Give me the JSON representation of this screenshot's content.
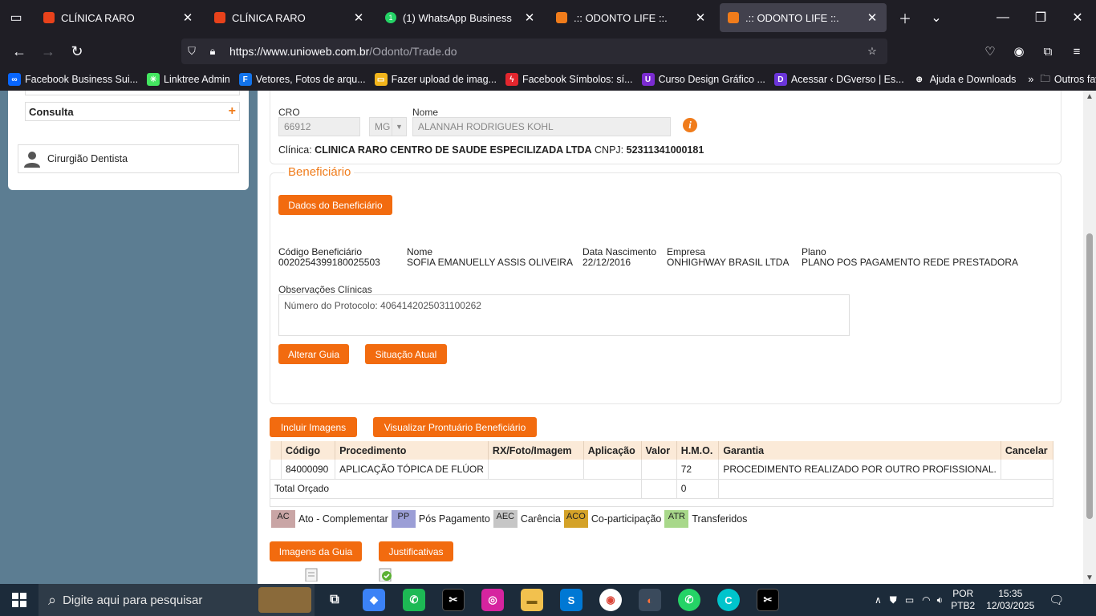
{
  "browser": {
    "tabs": [
      {
        "title": "CLÍNICA RARO",
        "fav_color": "#e8421b",
        "active": false
      },
      {
        "title": "CLÍNICA RARO",
        "fav_color": "#e8421b",
        "active": false
      },
      {
        "title": "(1) WhatsApp Business",
        "fav_color": "#25d366",
        "badge": "1",
        "active": false
      },
      {
        "title": ".:: ODONTO LIFE ::.",
        "fav_color": "#f07c1b",
        "active": false
      },
      {
        "title": ".:: ODONTO LIFE ::.",
        "fav_color": "#f07c1b",
        "active": true
      }
    ],
    "url_host": "https://www.unioweb.com.br",
    "url_path": "/Odonto/Trade.do",
    "bookmarks": [
      {
        "label": "Facebook Business Sui...",
        "color": "#0866ff",
        "glyph": "∞"
      },
      {
        "label": "Linktree Admin",
        "color": "#43e660",
        "glyph": "✳"
      },
      {
        "label": "Vetores, Fotos de arqu...",
        "color": "#1273eb",
        "glyph": "F"
      },
      {
        "label": "Fazer upload de imag...",
        "color": "#f2b51b",
        "glyph": "▭"
      },
      {
        "label": "Facebook Símbolos: sí...",
        "color": "#e3262e",
        "glyph": "ϟ"
      },
      {
        "label": "Curso Design Gráfico ...",
        "color": "#7b2bd1",
        "glyph": "U"
      },
      {
        "label": "Acessar ‹ DGverso | Es...",
        "color": "#6b35d9",
        "glyph": "D"
      },
      {
        "label": "Ajuda e Downloads",
        "color": "#1f1e25",
        "glyph": "⊕"
      }
    ],
    "other_bookmarks": "Outros favoritos"
  },
  "sidebar": {
    "consulta": "Consulta",
    "plus": "+",
    "profile": "Cirurgião Dentista"
  },
  "provider": {
    "cro_label": "CRO",
    "cro_value": "66912",
    "uf_value": "MG",
    "nome_label": "Nome",
    "nome_value": "ALANNAH RODRIGUES KOHL",
    "info_glyph": "i",
    "clinica_label": "Clínica:",
    "clinica_name": "CLINICA RARO CENTRO DE SAUDE ESPECILIZADA LTDA",
    "cnpj_label": "CNPJ:",
    "cnpj_value": "52311341000181"
  },
  "beneficiario": {
    "legend": "Beneficiário",
    "dados_button": "Dados do Beneficiário",
    "fields": [
      {
        "label": "Código Beneficiário",
        "value": "0020254399180025503"
      },
      {
        "label": "Nome",
        "value": "SOFIA EMANUELLY ASSIS OLIVEIRA"
      },
      {
        "label": "Data Nascimento",
        "value": "22/12/2016"
      },
      {
        "label": "Empresa",
        "value": "ONHIGHWAY BRASIL LTDA"
      },
      {
        "label": "Plano",
        "value": "PLANO POS PAGAMENTO REDE PRESTADORA"
      }
    ],
    "obs_label": "Observações Clínicas",
    "obs_text": "Número do Protocolo: 4064142025031100262",
    "alterar_button": "Alterar Guia",
    "situacao_button": "Situação Atual"
  },
  "actions": {
    "incluir_imagens": "Incluir Imagens",
    "visualizar_prontuario": "Visualizar Prontuário Beneficiário",
    "imagens_guia": "Imagens da Guia",
    "justificativas": "Justificativas"
  },
  "table": {
    "headers": [
      "",
      "Código",
      "Procedimento",
      "RX/Foto/Imagem",
      "Aplicação",
      "Valor",
      "H.M.O.",
      "Garantia",
      "Cancelar"
    ],
    "rows": [
      [
        "",
        "84000090",
        "APLICAÇÃO TÓPICA DE FLÚOR",
        "",
        "",
        "",
        "72",
        "PROCEDIMENTO REALIZADO POR OUTRO PROFISSIONAL.",
        ""
      ]
    ],
    "total_label": "Total Orçado",
    "total_hmo": "0"
  },
  "legend_chips": [
    {
      "code": "AC",
      "label": "Ato - Complementar",
      "color": "#c9a5a5"
    },
    {
      "code": "PP",
      "label": "Pós Pagamento",
      "color": "#9b9ed6"
    },
    {
      "code": "AEC",
      "label": "Carência",
      "color": "#c6c6c6"
    },
    {
      "code": "ACO",
      "label": "Co-participação",
      "color": "#d4a228"
    },
    {
      "code": "ATR",
      "label": "Transferidos",
      "color": "#a8d88a"
    }
  ],
  "taskbar": {
    "search_placeholder": "Digite aqui para pesquisar",
    "lang_top": "POR",
    "lang_bottom": "PTB2",
    "time": "15:35",
    "date": "12/03/2025"
  }
}
